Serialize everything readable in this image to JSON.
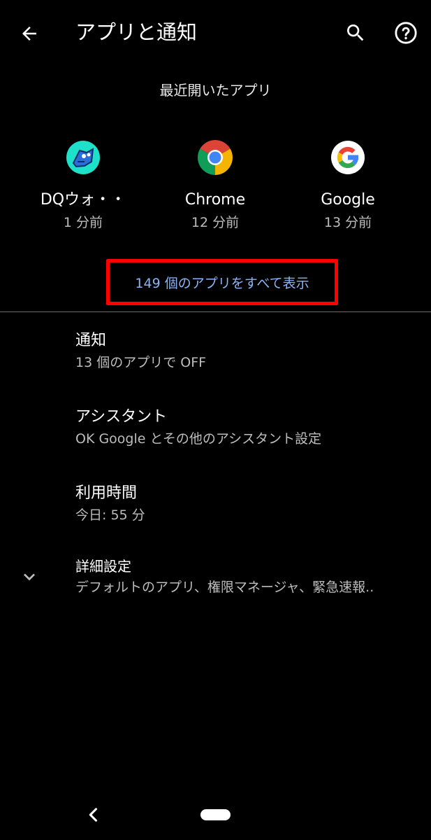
{
  "header": {
    "title": "アプリと通知"
  },
  "recent": {
    "label": "最近開いたアプリ",
    "apps": [
      {
        "name": "DQウォ・・",
        "time": "1 分前"
      },
      {
        "name": "Chrome",
        "time": "12 分前"
      },
      {
        "name": "Google",
        "time": "13 分前"
      }
    ],
    "show_all": "149 個のアプリをすべて表示"
  },
  "settings": [
    {
      "title": "通知",
      "subtitle": "13 個のアプリで OFF"
    },
    {
      "title": "アシスタント",
      "subtitle": "OK Google とその他のアシスタント設定"
    },
    {
      "title": "利用時間",
      "subtitle": "今日: 55 分"
    },
    {
      "title": "詳細設定",
      "subtitle": "デフォルトのアプリ、権限マネージャ、緊急速報.."
    }
  ],
  "colors": {
    "background": "#000000",
    "link": "#8ab4f8",
    "highlight": "#ff0000",
    "secondary_text": "#bdbdbd"
  },
  "icons": [
    "arrow-back-icon",
    "search-icon",
    "help-icon",
    "dq-walk-app-icon",
    "chrome-icon",
    "google-icon",
    "chevron-down-icon",
    "nav-back-icon"
  ]
}
